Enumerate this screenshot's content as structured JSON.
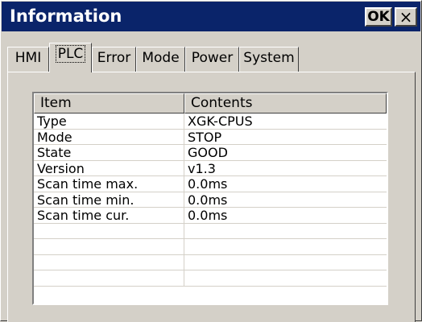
{
  "window": {
    "title": "Information",
    "ok_label": "OK",
    "close_label": "×"
  },
  "tabs": [
    {
      "label": "HMI",
      "active": false
    },
    {
      "label": "PLC",
      "active": true
    },
    {
      "label": "Error",
      "active": false
    },
    {
      "label": "Mode",
      "active": false
    },
    {
      "label": "Power",
      "active": false
    },
    {
      "label": "System",
      "active": false
    }
  ],
  "table": {
    "columns": [
      "Item",
      "Contents"
    ],
    "rows": [
      [
        "Type",
        "XGK-CPUS"
      ],
      [
        "Mode",
        "STOP"
      ],
      [
        "State",
        "GOOD"
      ],
      [
        "Version",
        "v1.3"
      ],
      [
        "Scan time max.",
        "0.0ms"
      ],
      [
        "Scan time min.",
        "0.0ms"
      ],
      [
        "Scan time cur.",
        "0.0ms"
      ],
      [
        "",
        ""
      ],
      [
        "",
        ""
      ],
      [
        "",
        ""
      ],
      [
        "",
        ""
      ]
    ]
  }
}
